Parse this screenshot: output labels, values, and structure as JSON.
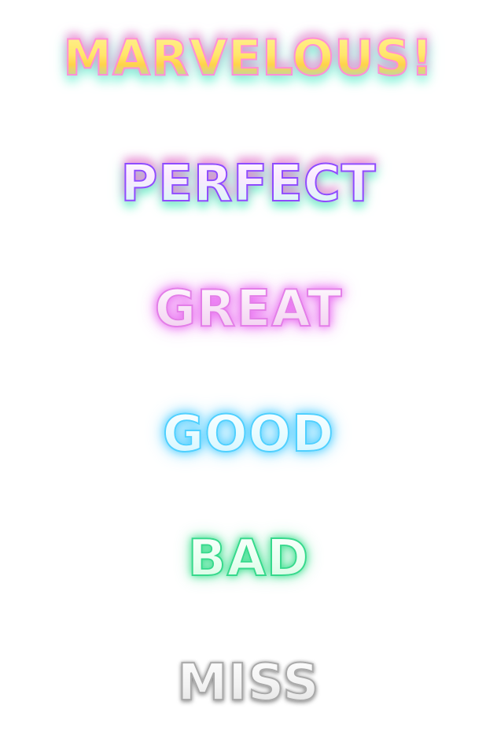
{
  "judgements": [
    {
      "label": "MARVELOUS!",
      "fill_color": "#ffe66b",
      "outline_color": "#ff8fd8",
      "glow_colors": [
        "#ff78d2",
        "#50f0c8"
      ]
    },
    {
      "label": "PERFECT",
      "fill_color": "#ffffff",
      "outline_color": "#8f4bff",
      "glow_colors": [
        "#ff6ed2",
        "#50f0be"
      ]
    },
    {
      "label": "GREAT",
      "fill_color": "#f7e0f6",
      "outline_color": "#e37ee8",
      "glow_colors": [
        "#e65af0"
      ]
    },
    {
      "label": "GOOD",
      "fill_color": "#e6fbff",
      "outline_color": "#4fd0ff",
      "glow_colors": [
        "#3cc8ff"
      ]
    },
    {
      "label": "BAD",
      "fill_color": "#e8fff0",
      "outline_color": "#36d98c",
      "glow_colors": [
        "#28dc82"
      ]
    },
    {
      "label": "MISS",
      "fill_color": "#f2f2f2",
      "outline_color": "#a9a9a9",
      "glow_colors": [
        "#555555"
      ]
    }
  ]
}
